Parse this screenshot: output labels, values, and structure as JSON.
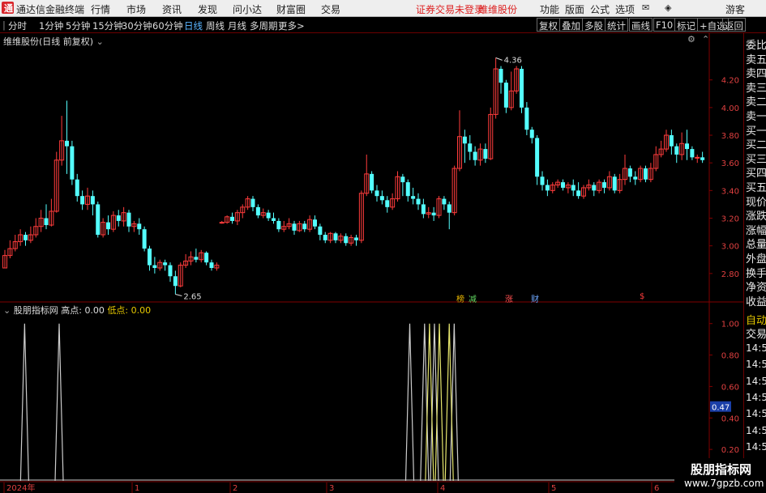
{
  "app_title": "通达信金融终端",
  "menu": [
    "行情",
    "市场",
    "资讯",
    "发现",
    "问小达",
    "财富圈",
    "交易"
  ],
  "notice": "证券交易未登录",
  "stock_name_top": "维维股份",
  "right_menu": [
    "功能",
    "版面",
    "公式",
    "选项"
  ],
  "guest": "游客",
  "periods": [
    "分时",
    "1分钟",
    "5分钟",
    "15分钟",
    "30分钟",
    "60分钟",
    "日线",
    "周线",
    "月线",
    "多周期",
    "更多>"
  ],
  "selected_period": "日线",
  "tools": [
    "复权",
    "叠加",
    "多股",
    "统计",
    "画线",
    "F10",
    "标记",
    "+自选",
    "返回"
  ],
  "chart_title": "维维股份(日线 前复权)",
  "price_labels": [
    "4.20",
    "4.00",
    "3.80",
    "3.60",
    "3.40",
    "3.20",
    "3.00",
    "2.80"
  ],
  "price_high": "4.36",
  "price_low": "2.65",
  "annotations": [
    {
      "text": "榜",
      "color": "#e6b400"
    },
    {
      "text": "减",
      "color": "#5fd35f"
    },
    {
      "text": "涨",
      "color": "#ff5050"
    },
    {
      "text": "财",
      "color": "#6ea8ff"
    },
    {
      "text": "$",
      "color": "#ff3c3c"
    }
  ],
  "indicator": {
    "name": "股朋指标网",
    "high_label": "高点:",
    "high_value": "0.00",
    "low_label": "低点:",
    "low_value": "0.00"
  },
  "indicator_labels": [
    "1.00",
    "0.80",
    "0.60",
    "0.40",
    "0.20"
  ],
  "indicator_current": "0.47",
  "date_labels": [
    "2024年",
    "1",
    "2",
    "3",
    "4",
    "5",
    "6"
  ],
  "side_items": [
    "委比",
    "卖五",
    "卖四",
    "卖三",
    "卖二",
    "卖一",
    "买一",
    "买二",
    "买三",
    "买四",
    "买五",
    "现价",
    "涨跌",
    "涨幅",
    "总量",
    "外盘",
    "换手",
    "净资",
    "收益"
  ],
  "side_bottom": [
    "自动",
    "交易"
  ],
  "side_times": [
    "14:56",
    "14:56",
    "14:56",
    "14:56",
    "14:56",
    "14:56",
    "14:56",
    "14:56",
    "14:56"
  ],
  "watermark": {
    "line1": "股朋指标网",
    "line2": "www.7gpzb.com"
  },
  "colors": {
    "up": "#ff3c3c",
    "down": "#54ffff",
    "grid": "#800000",
    "line_white": "#cccccc",
    "line_yellow": "#e6e66e"
  },
  "chart_data": {
    "type": "candlestick",
    "title": "维维股份(日线 前复权)",
    "y_range": [
      2.6,
      4.45
    ],
    "candles": [
      [
        2.84,
        2.93,
        2.84,
        2.97
      ],
      [
        2.93,
        2.98,
        2.91,
        3.04
      ],
      [
        2.98,
        3.03,
        2.96,
        3.08
      ],
      [
        3.03,
        3.08,
        3.0,
        3.12
      ],
      [
        3.08,
        3.04,
        3.0,
        3.1
      ],
      [
        3.04,
        3.08,
        3.02,
        3.14
      ],
      [
        3.08,
        3.14,
        3.06,
        3.2
      ],
      [
        3.14,
        3.2,
        3.1,
        3.26
      ],
      [
        3.2,
        3.15,
        3.12,
        3.3
      ],
      [
        3.15,
        3.25,
        3.14,
        3.34
      ],
      [
        3.25,
        3.62,
        3.24,
        3.68
      ],
      [
        3.62,
        3.76,
        3.58,
        3.94
      ],
      [
        3.76,
        3.72,
        3.52,
        4.05
      ],
      [
        3.72,
        3.48,
        3.44,
        3.76
      ],
      [
        3.48,
        3.36,
        3.32,
        3.52
      ],
      [
        3.36,
        3.3,
        3.26,
        3.4
      ],
      [
        3.3,
        3.36,
        3.26,
        3.42
      ],
      [
        3.36,
        3.3,
        3.22,
        3.4
      ],
      [
        3.3,
        3.08,
        3.06,
        3.32
      ],
      [
        3.08,
        3.17,
        3.06,
        3.2
      ],
      [
        3.17,
        3.12,
        3.08,
        3.22
      ],
      [
        3.12,
        3.22,
        3.1,
        3.25
      ],
      [
        3.22,
        3.18,
        3.14,
        3.26
      ],
      [
        3.18,
        3.24,
        3.14,
        3.28
      ],
      [
        3.24,
        3.14,
        3.1,
        3.26
      ],
      [
        3.14,
        3.16,
        3.1,
        3.18
      ],
      [
        3.16,
        3.12,
        3.08,
        3.2
      ],
      [
        3.12,
        2.98,
        2.96,
        3.14
      ],
      [
        2.98,
        2.86,
        2.82,
        3.0
      ],
      [
        2.86,
        2.84,
        2.8,
        2.92
      ],
      [
        2.84,
        2.88,
        2.82,
        2.9
      ],
      [
        2.88,
        2.86,
        2.82,
        2.9
      ],
      [
        2.86,
        2.78,
        2.74,
        2.88
      ],
      [
        2.78,
        2.71,
        2.65,
        2.82
      ],
      [
        2.71,
        2.86,
        2.7,
        2.88
      ],
      [
        2.86,
        2.89,
        2.84,
        2.94
      ],
      [
        2.89,
        2.92,
        2.86,
        2.96
      ],
      [
        2.92,
        2.9,
        2.88,
        2.98
      ],
      [
        2.9,
        2.95,
        2.88,
        2.97
      ],
      [
        2.95,
        2.88,
        2.86,
        2.96
      ],
      [
        2.88,
        2.84,
        2.82,
        2.9
      ],
      [
        2.84,
        2.86,
        2.82,
        2.88
      ],
      [
        3.17,
        3.17,
        3.16,
        3.18
      ],
      [
        3.17,
        3.21,
        3.16,
        3.22
      ],
      [
        3.21,
        3.18,
        3.16,
        3.24
      ],
      [
        3.18,
        3.24,
        3.15,
        3.26
      ],
      [
        3.24,
        3.28,
        3.2,
        3.3
      ],
      [
        3.28,
        3.34,
        3.26,
        3.36
      ],
      [
        3.34,
        3.28,
        3.25,
        3.36
      ],
      [
        3.28,
        3.22,
        3.2,
        3.3
      ],
      [
        3.22,
        3.24,
        3.2,
        3.27
      ],
      [
        3.24,
        3.2,
        3.18,
        3.26
      ],
      [
        3.2,
        3.18,
        3.16,
        3.24
      ],
      [
        3.18,
        3.12,
        3.1,
        3.2
      ],
      [
        3.12,
        3.14,
        3.1,
        3.18
      ],
      [
        3.14,
        3.16,
        3.12,
        3.2
      ],
      [
        3.16,
        3.11,
        3.08,
        3.18
      ],
      [
        3.11,
        3.16,
        3.1,
        3.18
      ],
      [
        3.16,
        3.12,
        3.1,
        3.18
      ],
      [
        3.12,
        3.19,
        3.1,
        3.22
      ],
      [
        3.19,
        3.14,
        3.12,
        3.22
      ],
      [
        3.14,
        3.08,
        3.04,
        3.16
      ],
      [
        3.08,
        3.04,
        3.02,
        3.1
      ],
      [
        3.04,
        3.09,
        3.02,
        3.1
      ],
      [
        3.09,
        3.04,
        3.02,
        3.1
      ],
      [
        3.04,
        3.07,
        3.02,
        3.09
      ],
      [
        3.07,
        3.02,
        3.0,
        3.09
      ],
      [
        3.02,
        3.06,
        3.0,
        3.08
      ],
      [
        3.06,
        3.04,
        3.0,
        3.08
      ],
      [
        3.04,
        3.38,
        3.02,
        3.4
      ],
      [
        3.38,
        3.52,
        3.36,
        3.66
      ],
      [
        3.52,
        3.4,
        3.38,
        3.54
      ],
      [
        3.4,
        3.36,
        3.32,
        3.44
      ],
      [
        3.36,
        3.33,
        3.3,
        3.4
      ],
      [
        3.33,
        3.28,
        3.24,
        3.36
      ],
      [
        3.28,
        3.34,
        3.26,
        3.38
      ],
      [
        3.34,
        3.5,
        3.32,
        3.54
      ],
      [
        3.5,
        3.46,
        3.36,
        3.52
      ],
      [
        3.46,
        3.36,
        3.32,
        3.48
      ],
      [
        3.36,
        3.34,
        3.3,
        3.42
      ],
      [
        3.34,
        3.3,
        3.26,
        3.38
      ],
      [
        3.3,
        3.23,
        3.2,
        3.34
      ],
      [
        3.23,
        3.24,
        3.2,
        3.28
      ],
      [
        3.24,
        3.22,
        3.18,
        3.28
      ],
      [
        3.22,
        3.34,
        3.2,
        3.36
      ],
      [
        3.34,
        3.3,
        3.26,
        3.36
      ],
      [
        3.3,
        3.24,
        3.12,
        3.32
      ],
      [
        3.24,
        3.56,
        3.22,
        3.58
      ],
      [
        3.56,
        3.79,
        3.54,
        3.98
      ],
      [
        3.79,
        3.74,
        3.6,
        3.84
      ],
      [
        3.74,
        3.68,
        3.62,
        3.8
      ],
      [
        3.68,
        3.62,
        3.58,
        3.72
      ],
      [
        3.62,
        3.7,
        3.58,
        3.74
      ],
      [
        3.7,
        3.63,
        3.6,
        3.74
      ],
      [
        3.63,
        3.95,
        3.62,
        4.0
      ],
      [
        3.95,
        4.28,
        3.92,
        4.36
      ],
      [
        4.28,
        4.18,
        4.1,
        4.3
      ],
      [
        4.18,
        4.0,
        3.96,
        4.2
      ],
      [
        4.0,
        4.12,
        3.98,
        4.26
      ],
      [
        4.12,
        4.28,
        4.1,
        4.3
      ],
      [
        4.28,
        4.0,
        3.96,
        4.3
      ],
      [
        4.0,
        3.84,
        3.8,
        4.04
      ],
      [
        3.84,
        3.78,
        3.74,
        3.86
      ],
      [
        3.78,
        3.5,
        3.44,
        3.8
      ],
      [
        3.5,
        3.44,
        3.4,
        3.54
      ],
      [
        3.44,
        3.4,
        3.36,
        3.48
      ],
      [
        3.4,
        3.44,
        3.38,
        3.46
      ],
      [
        3.44,
        3.46,
        3.42,
        3.48
      ],
      [
        3.46,
        3.42,
        3.4,
        3.48
      ],
      [
        3.42,
        3.44,
        3.38,
        3.46
      ],
      [
        3.44,
        3.4,
        3.36,
        3.48
      ],
      [
        3.4,
        3.36,
        3.34,
        3.46
      ],
      [
        3.36,
        3.42,
        3.34,
        3.44
      ],
      [
        3.42,
        3.44,
        3.4,
        3.48
      ],
      [
        3.44,
        3.4,
        3.36,
        3.46
      ],
      [
        3.4,
        3.46,
        3.38,
        3.48
      ],
      [
        3.46,
        3.42,
        3.38,
        3.48
      ],
      [
        3.42,
        3.5,
        3.4,
        3.54
      ],
      [
        3.5,
        3.4,
        3.38,
        3.52
      ],
      [
        3.4,
        3.48,
        3.38,
        3.52
      ],
      [
        3.48,
        3.56,
        3.44,
        3.66
      ],
      [
        3.56,
        3.5,
        3.46,
        3.58
      ],
      [
        3.5,
        3.48,
        3.44,
        3.54
      ],
      [
        3.48,
        3.56,
        3.46,
        3.58
      ],
      [
        3.56,
        3.48,
        3.46,
        3.58
      ],
      [
        3.48,
        3.56,
        3.46,
        3.6
      ],
      [
        3.56,
        3.66,
        3.54,
        3.72
      ],
      [
        3.66,
        3.7,
        3.64,
        3.76
      ],
      [
        3.7,
        3.8,
        3.68,
        3.84
      ],
      [
        3.8,
        3.72,
        3.66,
        3.84
      ],
      [
        3.72,
        3.66,
        3.6,
        3.74
      ],
      [
        3.66,
        3.74,
        3.62,
        3.82
      ],
      [
        3.74,
        3.7,
        3.62,
        3.84
      ],
      [
        3.7,
        3.64,
        3.62,
        3.72
      ],
      [
        3.64,
        3.64,
        3.6,
        3.66
      ],
      [
        3.64,
        3.62,
        3.6,
        3.68
      ]
    ],
    "indicator_x_range": [
      0,
      142
    ],
    "indicator_y_range": [
      0,
      1.05
    ],
    "indicator_series": [
      {
        "color": "white",
        "spikes": [
          [
            4,
            1
          ],
          [
            11,
            1
          ],
          [
            82,
            1
          ],
          [
            85,
            1
          ],
          [
            87,
            1
          ],
          [
            91,
            1
          ]
        ]
      },
      {
        "color": "yellow",
        "spikes": [
          [
            86,
            1
          ],
          [
            88,
            1
          ],
          [
            90,
            1
          ]
        ]
      }
    ]
  }
}
